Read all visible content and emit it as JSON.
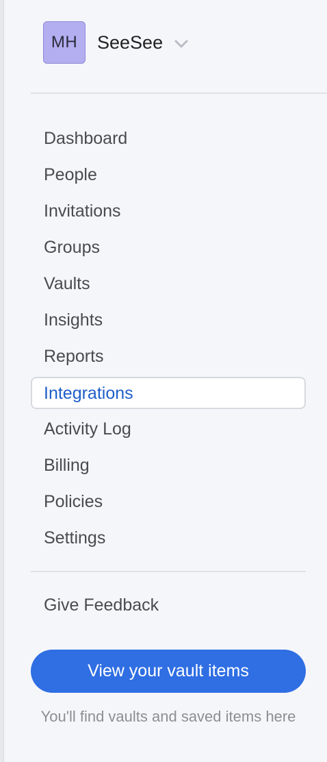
{
  "account": {
    "initials": "MH",
    "name": "SeeSee",
    "icon": "chevron-down-icon"
  },
  "nav": {
    "items": [
      {
        "label": "Dashboard",
        "active": false
      },
      {
        "label": "People",
        "active": false
      },
      {
        "label": "Invitations",
        "active": false
      },
      {
        "label": "Groups",
        "active": false
      },
      {
        "label": "Vaults",
        "active": false
      },
      {
        "label": "Insights",
        "active": false
      },
      {
        "label": "Reports",
        "active": false
      },
      {
        "label": "Integrations",
        "active": true
      },
      {
        "label": "Activity Log",
        "active": false
      },
      {
        "label": "Billing",
        "active": false
      },
      {
        "label": "Policies",
        "active": false
      },
      {
        "label": "Settings",
        "active": false
      }
    ]
  },
  "feedback": {
    "label": "Give Feedback"
  },
  "vault_button": {
    "label": "View your vault items"
  },
  "hint": {
    "text": "You'll find vaults and saved items here"
  },
  "colors": {
    "accent": "#2f6ee3",
    "active_text": "#1f5fc9",
    "avatar_bg": "#b3aef0",
    "sidebar_bg": "#f5f6fa"
  }
}
